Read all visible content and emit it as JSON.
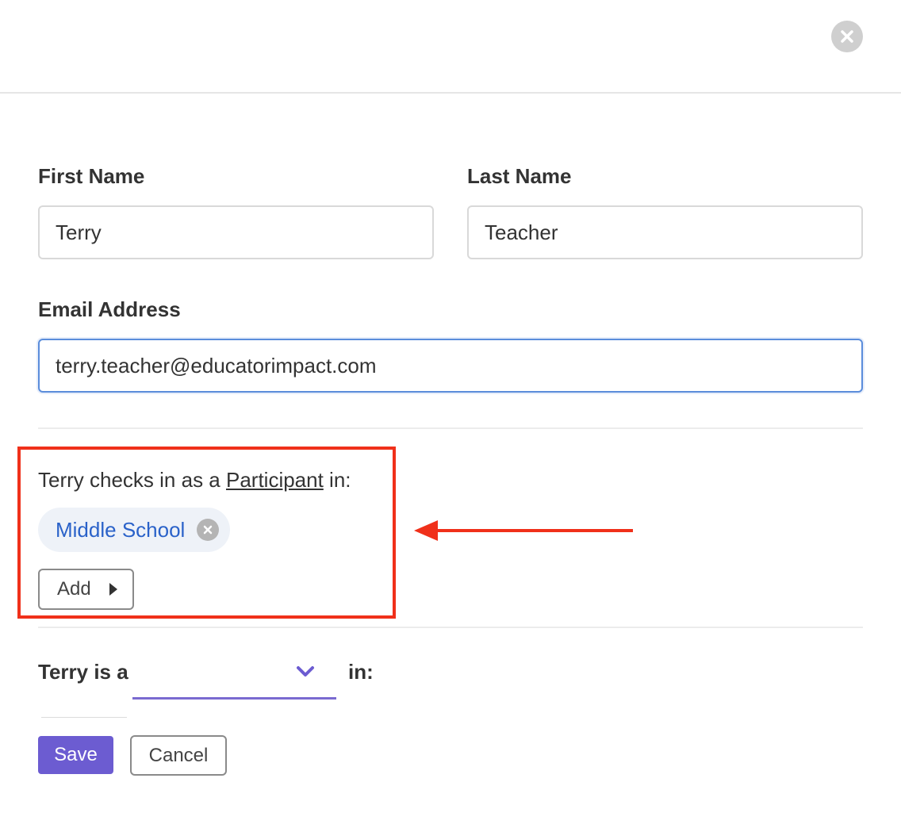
{
  "form": {
    "first_name": {
      "label": "First Name",
      "value": "Terry"
    },
    "last_name": {
      "label": "Last Name",
      "value": "Teacher"
    },
    "email": {
      "label": "Email Address",
      "value": "terry.teacher@educatorimpact.com"
    }
  },
  "participant": {
    "prefix": "Terry checks in as a ",
    "role": "Participant",
    "suffix": " in:",
    "groups": [
      {
        "label": "Middle School"
      }
    ],
    "add_label": "Add"
  },
  "role_assignment": {
    "prefix": "Terry is a",
    "selected": "",
    "suffix": "in:"
  },
  "actions": {
    "save_label": "Save",
    "cancel_label": "Cancel"
  },
  "icons": {
    "close": "close-icon",
    "chip_remove": "remove-icon",
    "add_caret": "caret-right-icon",
    "select_chevron": "chevron-down-icon",
    "annotation": "arrow-left-icon"
  },
  "colors": {
    "accent": "#6c5cd1",
    "chip_text": "#2a62c9",
    "chip_bg": "#eef2f8",
    "highlight": "#f0301a",
    "focus_border": "#5b8ddb"
  }
}
